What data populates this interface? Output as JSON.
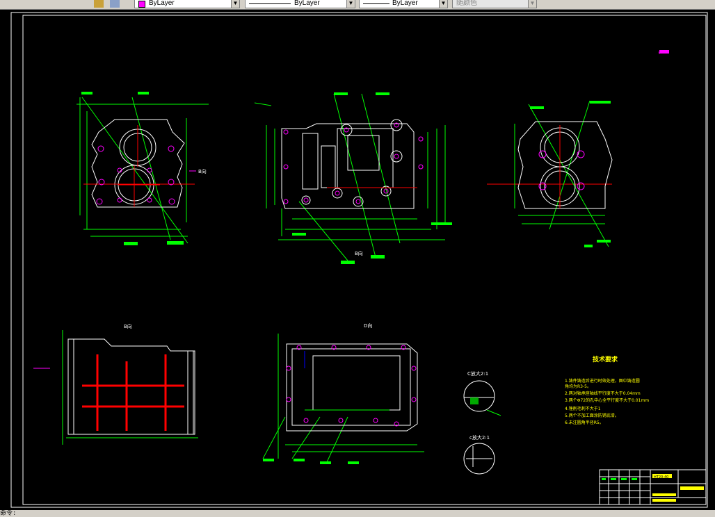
{
  "toolbar": {
    "color_value": "ByLayer",
    "linetype_value": "ByLayer",
    "lineweight_value": "ByLayer",
    "plotstyle_value": "随颜色"
  },
  "drawing": {
    "section_labels": [
      "B向",
      "B向",
      "B向",
      "D向"
    ],
    "detail_c": "C放大2:1",
    "detail_d": "c放大2:1",
    "tech_title": "技术要求",
    "tech_notes": [
      "1.铸件铸造后进行时效处理，图中铸造圆",
      "角均为R3-5。",
      "2.两对轴承座轴线平行度不大于0.04mm",
      "3.两个Φ72的孔中心全平行度不大于0.01mm",
      "4.锉削毛刺不大于1",
      "5.两个不加工面涂防锈底漆。",
      "6.未注圆角半径R5。"
    ],
    "title_block_name": "HT20-40"
  },
  "status": {
    "command_line": "命令:"
  },
  "colors": {
    "line": "#ffffff",
    "dim": "#00ff00",
    "accent": "#ff00ff",
    "text": "#ffff00",
    "center": "#ff0000",
    "hidden": "#0000ff"
  }
}
